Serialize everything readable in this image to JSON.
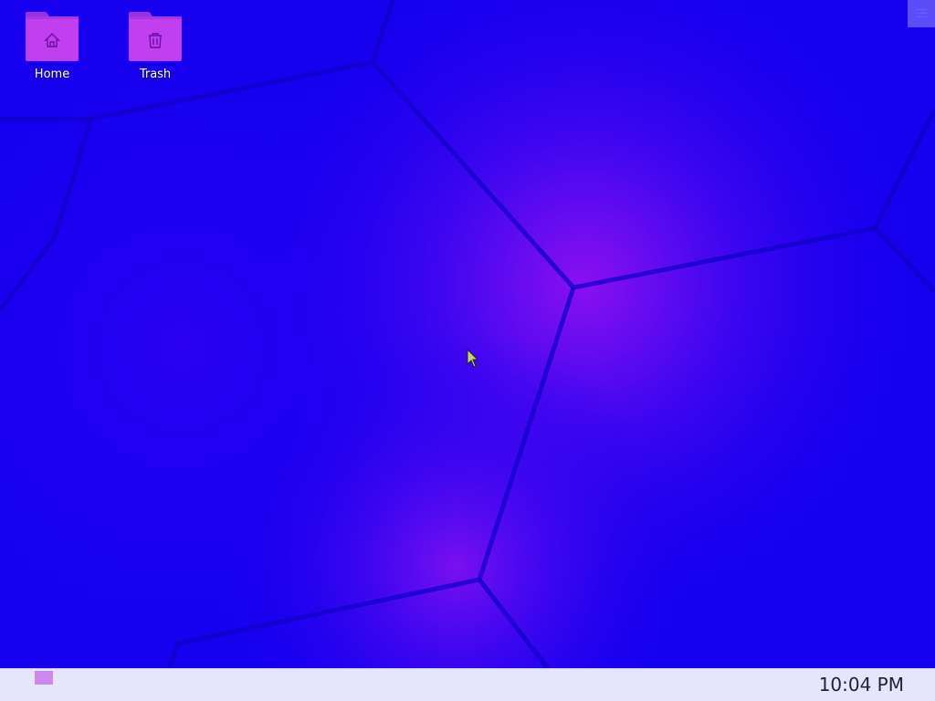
{
  "desktop": {
    "icons": [
      {
        "label": "Home",
        "icon": "home-icon"
      },
      {
        "label": "Trash",
        "icon": "trash-icon"
      }
    ],
    "colors": {
      "wallpaper_base": "#1a00f0",
      "wallpaper_glow": "#8a10f0",
      "folder": "#c040f0",
      "taskbar": "#e6e6fb"
    }
  },
  "topbar": {
    "menu_icon": "menu-icon"
  },
  "taskbar": {
    "start_icon": "start-menu-icon",
    "clock": "10:04 PM"
  }
}
